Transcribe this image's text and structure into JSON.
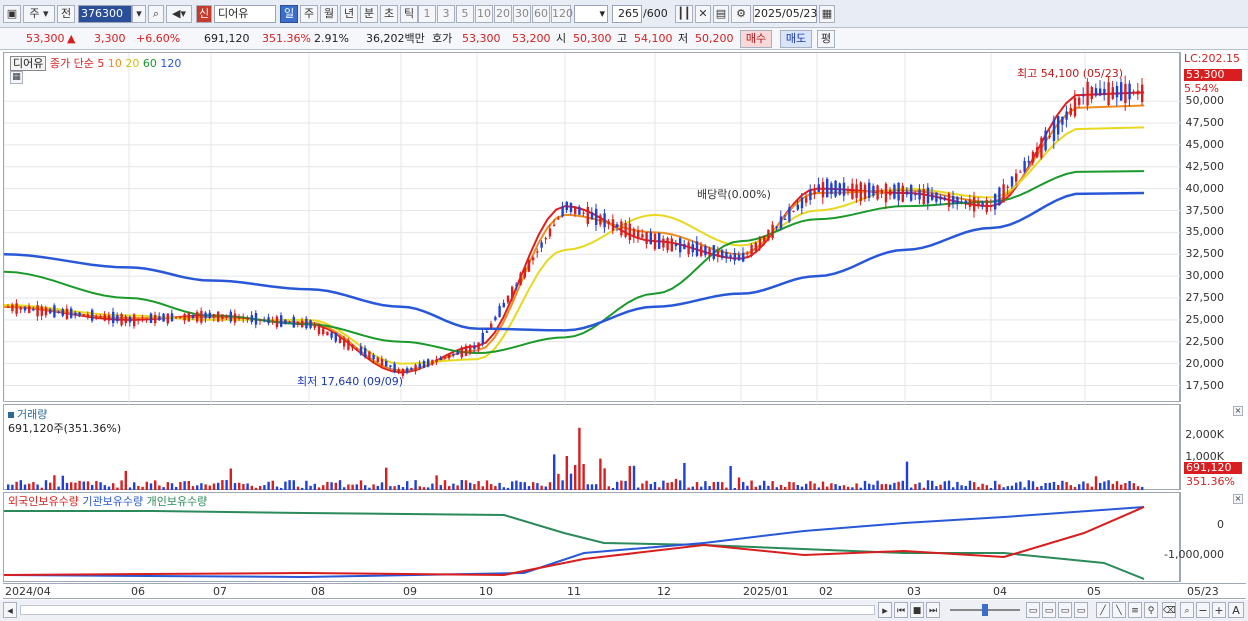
{
  "toolbar": {
    "market": "주",
    "prev_label": "전",
    "code": "376300",
    "new_badge": "신",
    "name": "디어유",
    "periods": [
      "일",
      "주",
      "월",
      "년",
      "분",
      "초",
      "틱"
    ],
    "active_period": "일",
    "ticks": [
      "1",
      "3",
      "5",
      "10",
      "20",
      "30",
      "60",
      "120"
    ],
    "count": "265",
    "count_total": "/600",
    "date": "2025/05/23"
  },
  "quote": {
    "price": "53,300",
    "arrow": "▲",
    "change": "3,300",
    "change_pct": "+6.60%",
    "volume": "691,120",
    "vol_ratio": "351.36%",
    "turnover": "2.91%",
    "amount": "36,202백만",
    "hoga_label": "호가",
    "ask": "53,300",
    "bid": "53,200",
    "open_label": "시",
    "open": "50,300",
    "high_label": "고",
    "high": "54,100",
    "low_label": "저",
    "low": "50,200",
    "buy_label": "매수",
    "sell_label": "매도",
    "eval_label": "평"
  },
  "price_panel": {
    "legend_name": "디어유",
    "legend_ma_title": "종가 단순",
    "ma": [
      {
        "period": "5",
        "color": "#e02020"
      },
      {
        "period": "10",
        "color": "#f08c1c"
      },
      {
        "period": "20",
        "color": "#e8d820"
      },
      {
        "period": "60",
        "color": "#1a9a2a"
      },
      {
        "period": "120",
        "color": "#2858d8"
      }
    ],
    "lc_label": "LC:202.15",
    "last_price": "53,300",
    "last_pct": "5.54%",
    "high_annotation": "최고 54,100 (05/23)",
    "low_annotation": "최저 17,640 (09/09)",
    "dividend_annotation": "배당락(0.00%)",
    "y_ticks": [
      "50,000",
      "47,500",
      "45,000",
      "42,500",
      "40,000",
      "37,500",
      "35,000",
      "32,500",
      "30,000",
      "27,500",
      "25,000",
      "22,500",
      "20,000",
      "17,500"
    ]
  },
  "volume_panel": {
    "title": "거래량",
    "sub": "691,120주(351.36%)",
    "y_ticks": [
      "2,000K",
      "1,000K"
    ],
    "last_value": "691,120",
    "last_pct": "351.36%"
  },
  "holding_panel": {
    "legend": [
      {
        "label": "외국인보유수량",
        "color": "#d81e1e"
      },
      {
        "label": "기관보유수량",
        "color": "#2858d8"
      },
      {
        "label": "개인보유수량",
        "color": "#2a8a5a"
      }
    ],
    "y_ticks": [
      "0",
      "-1,000,000"
    ]
  },
  "x_labels": [
    "2024/04",
    "06",
    "07",
    "08",
    "09",
    "10",
    "11",
    "12",
    "2025/01",
    "02",
    "03",
    "04",
    "05",
    "05/23"
  ],
  "chart_data": {
    "type": "line",
    "title": "",
    "x": [
      "2024/04",
      "06",
      "07",
      "08",
      "09",
      "10",
      "11",
      "12",
      "2025/01",
      "02",
      "03",
      "04",
      "05"
    ],
    "series": [
      {
        "name": "5",
        "values": [
          26500,
          25000,
          25500,
          24500,
          19000,
          22000,
          38000,
          34000,
          32000,
          40000,
          39500,
          38000,
          51000
        ]
      },
      {
        "name": "10",
        "values": [
          26500,
          25200,
          25300,
          24700,
          19200,
          21500,
          37000,
          35000,
          32500,
          39500,
          39800,
          38500,
          49500
        ]
      },
      {
        "name": "20",
        "values": [
          26700,
          25500,
          25000,
          25000,
          20000,
          20500,
          33000,
          37000,
          33500,
          37500,
          40000,
          39000,
          47000
        ]
      },
      {
        "name": "60",
        "values": [
          30500,
          27500,
          25500,
          24500,
          22500,
          21200,
          23000,
          28000,
          34000,
          36500,
          38000,
          38500,
          42000
        ]
      },
      {
        "name": "120",
        "values": [
          32500,
          31000,
          29500,
          28500,
          26500,
          24000,
          23800,
          26500,
          28000,
          30000,
          33000,
          35500,
          39500
        ]
      }
    ],
    "ylim": [
      15500,
      55500
    ],
    "grid": true,
    "legend": "top-left"
  }
}
